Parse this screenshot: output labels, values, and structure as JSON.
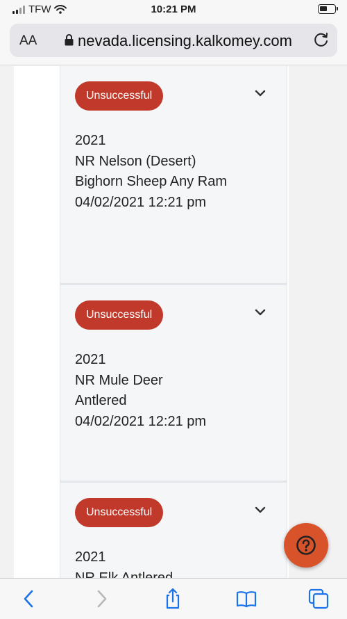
{
  "status_bar": {
    "carrier": "TFW",
    "time": "10:21 PM"
  },
  "browser": {
    "text_size_label": "AA",
    "url": "nevada.licensing.kalkomey.com"
  },
  "results": [
    {
      "status": "Unsuccessful",
      "year": "2021",
      "hunt": "NR Nelson (Desert) Bighorn Sheep Any Ram",
      "date": "04/02/2021 12:21 pm"
    },
    {
      "status": "Unsuccessful",
      "year": "2021",
      "hunt": "NR Mule Deer Antlered",
      "date": "04/02/2021 12:21 pm"
    },
    {
      "status": "Unsuccessful",
      "year": "2021",
      "hunt": "NR Elk Antlered",
      "date": ""
    }
  ],
  "colors": {
    "badge": "#c0392b",
    "help_button": "#d9532a",
    "ios_blue": "#1a73e8"
  }
}
